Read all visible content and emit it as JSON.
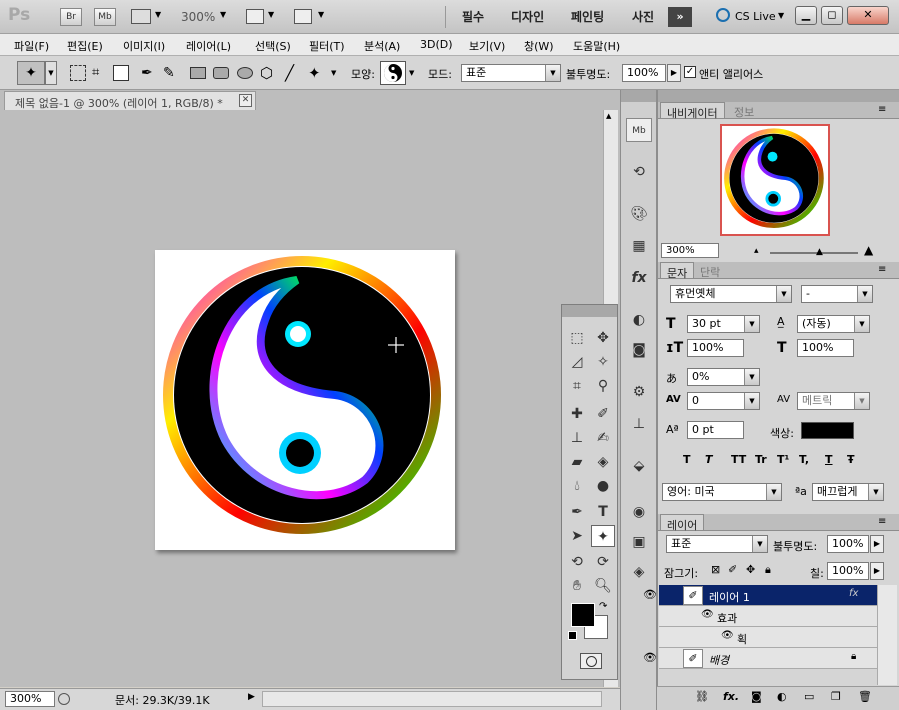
{
  "appbar": {
    "logo": "Ps",
    "br": "Br",
    "mb": "Mb",
    "zoom": "300%",
    "workspaces": [
      "필수",
      "디자인",
      "페인팅",
      "사진"
    ],
    "cs_live": "CS Live"
  },
  "menu": [
    "파일(F)",
    "편집(E)",
    "이미지(I)",
    "레이어(L)",
    "선택(S)",
    "필터(T)",
    "분석(A)",
    "3D(D)",
    "보기(V)",
    "창(W)",
    "도움말(H)"
  ],
  "options": {
    "shape_label": "모양:",
    "mode_label": "모드:",
    "mode_value": "표준",
    "opacity_label": "불투명도:",
    "opacity_value": "100%",
    "antialias_label": "앤티 앨리어스",
    "antialias_checked": true
  },
  "document": {
    "tab_title": "제목 없음-1 @ 300% (레이어 1, RGB/8) *",
    "zoom": "300%",
    "doc_info": "문서: 29.3K/39.1K"
  },
  "navigator": {
    "tabs": [
      "내비게이터",
      "정보"
    ],
    "zoom": "300%"
  },
  "character": {
    "tabs": [
      "문자",
      "단락"
    ],
    "font": "휴먼옛체",
    "style": "-",
    "size": "30 pt",
    "leading": "(자동)",
    "vscale": "100%",
    "hscale": "100%",
    "baseline_shift": "0%",
    "tracking": "0",
    "kerning": "메트릭",
    "baseline": "0 pt",
    "color_label": "색상:",
    "color": "#000000",
    "language": "영어: 미국",
    "aa_label": "ªa",
    "antialias": "매끄럽게",
    "style_buttons": [
      "T",
      "T",
      "TT",
      "Tr",
      "T¹",
      "T,",
      "T",
      "Ŧ"
    ]
  },
  "layers": {
    "tab": "레이어",
    "blend": "표준",
    "opacity_label": "불투명도:",
    "opacity": "100%",
    "lock_label": "잠그기:",
    "fill_label": "칠:",
    "fill": "100%",
    "items": [
      {
        "name": "레이어 1",
        "selected": true
      },
      {
        "name": "효과",
        "sub": true
      },
      {
        "name": "획",
        "sub2": true
      },
      {
        "name": "배경",
        "locked": true
      }
    ]
  },
  "colors": {
    "accent": "#0a246a",
    "panel": "#d5d5d5",
    "canvas_bg": "#bdbdbd"
  }
}
